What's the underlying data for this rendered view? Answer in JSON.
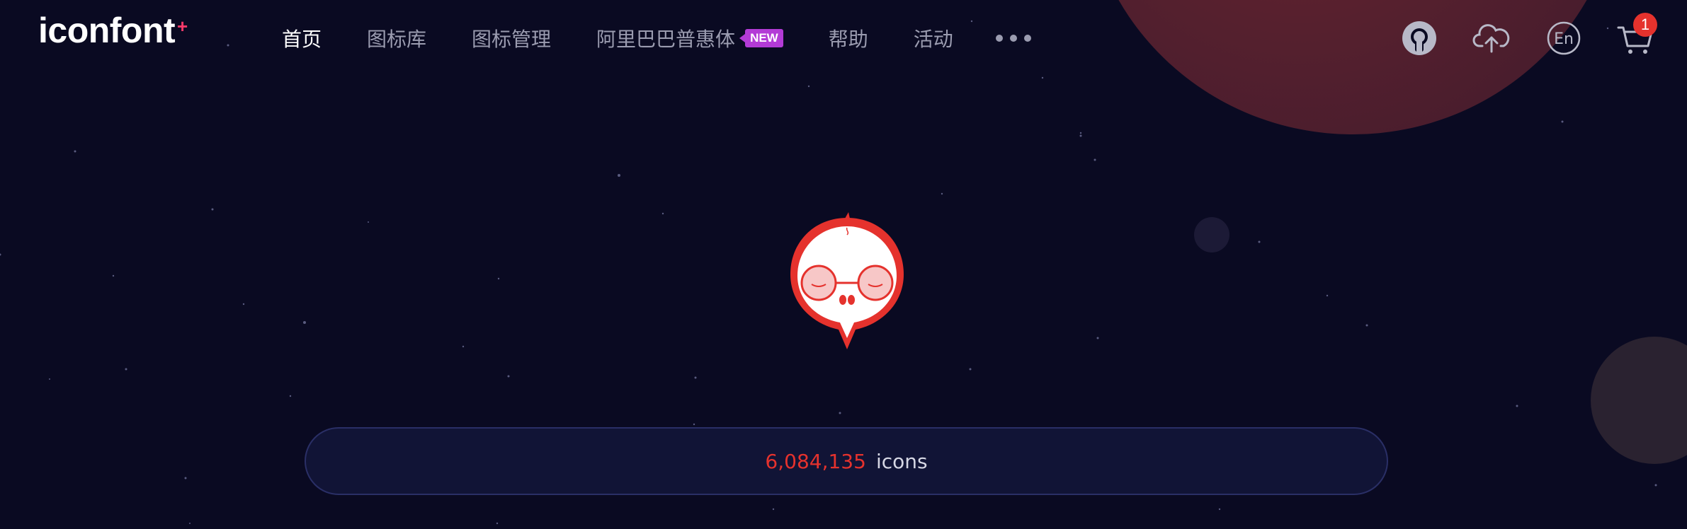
{
  "logo": {
    "text": "iconfont",
    "plus": "+"
  },
  "nav": {
    "items": [
      {
        "label": "首页",
        "active": true
      },
      {
        "label": "图标库",
        "active": false
      },
      {
        "label": "图标管理",
        "active": false
      },
      {
        "label": "阿里巴巴普惠体",
        "active": false,
        "badge": "NEW"
      },
      {
        "label": "帮助",
        "active": false
      },
      {
        "label": "活动",
        "active": false
      }
    ],
    "more_icon": "ellipsis-icon"
  },
  "tools": {
    "github_icon": "github-icon",
    "upload_icon": "cloud-upload-icon",
    "language_label": "En",
    "cart_icon": "cart-icon",
    "cart_count": "1"
  },
  "hero": {
    "mascot_icon": "mascot-icon",
    "icon_count": "6,084,135",
    "icon_count_unit": "icons"
  },
  "colors": {
    "background": "#0a0a22",
    "accent_red": "#e5322d",
    "badge_purple": "#b33bd6",
    "nav_text": "#9b9cb0"
  }
}
